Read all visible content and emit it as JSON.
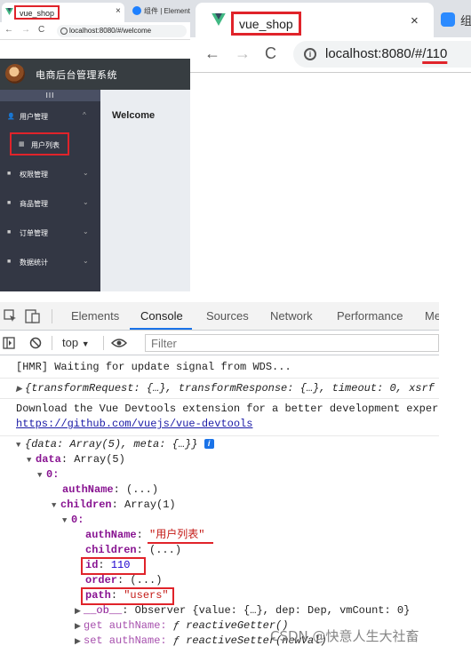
{
  "small_browser": {
    "tab_title": "vue_shop",
    "tab_close": "×",
    "tab2_title": "组件 | Element",
    "nav": {
      "back": "←",
      "forward": "→",
      "reload": "C"
    },
    "url": "localhost:8080/#/welcome",
    "app_title": "电商后台管理系统",
    "toggle": "III",
    "menu": [
      {
        "icon": "👤",
        "label": "用户管理",
        "chevron": "^"
      },
      {
        "icon": "■",
        "label": "权限管理",
        "chevron": "⌄"
      },
      {
        "icon": "■",
        "label": "商品管理",
        "chevron": "⌄"
      },
      {
        "icon": "■",
        "label": "订单管理",
        "chevron": "⌄"
      },
      {
        "icon": "■",
        "label": "数据统计",
        "chevron": "⌄"
      }
    ],
    "submenu_icon": "▦",
    "submenu_label": "用户列表",
    "welcome": "Welcome"
  },
  "large_browser": {
    "tab_title": "vue_shop",
    "tab_close": "×",
    "tab2_title": "组",
    "nav": {
      "back": "←",
      "forward": "→",
      "reload": "C"
    },
    "url_icon": "i",
    "url_host": "localhost:8080/#",
    "url_path": "/110"
  },
  "devtools": {
    "tabs": [
      "Elements",
      "Console",
      "Sources",
      "Network",
      "Performance",
      "Me"
    ],
    "active_tab": "Console",
    "context": "top",
    "filter_placeholder": "Filter",
    "lines": {
      "hmr": "[HMR] Waiting for update signal from WDS...",
      "transform": "{transformRequest: {…}, transformResponse: {…}, timeout: 0, xsrf",
      "devtools_msg": "Download the Vue Devtools extension for a better development exper",
      "devtools_link": "https://github.com/vuejs/vue-devtools",
      "res_obj": "{data: Array(5), meta: {…}}",
      "info": "i",
      "data_key": "data",
      "data_val": "Array(5)",
      "idx0": "0:",
      "authName_key": "authName",
      "authName_val": "(...)",
      "children_key": "children",
      "children_val": "Array(1)",
      "child0": "0:",
      "c_authName_key": "authName",
      "c_authName_val": "\"用户列表\"",
      "c_children_key": "children",
      "c_children_val": "(...)",
      "c_id_key": "id",
      "c_id_val": "110",
      "c_order_key": "order",
      "c_order_val": "(...)",
      "c_path_key": "path",
      "c_path_val": "\"users\"",
      "ob_key": "__ob__",
      "ob_val": "Observer {value: {…}, dep: Dep, vmCount: 0}",
      "get_prefix": "get authName:",
      "get_val": "ƒ reactiveGetter()",
      "set_prefix": "set authName:",
      "set_val": "ƒ reactiveSetter(newVal)"
    }
  },
  "watermark": "CSDN @快意人生大社畜",
  "colors": {
    "annotation": "#e0232a",
    "sidebar": "#333744",
    "header": "#373d41",
    "vue_green": "#41b883"
  }
}
